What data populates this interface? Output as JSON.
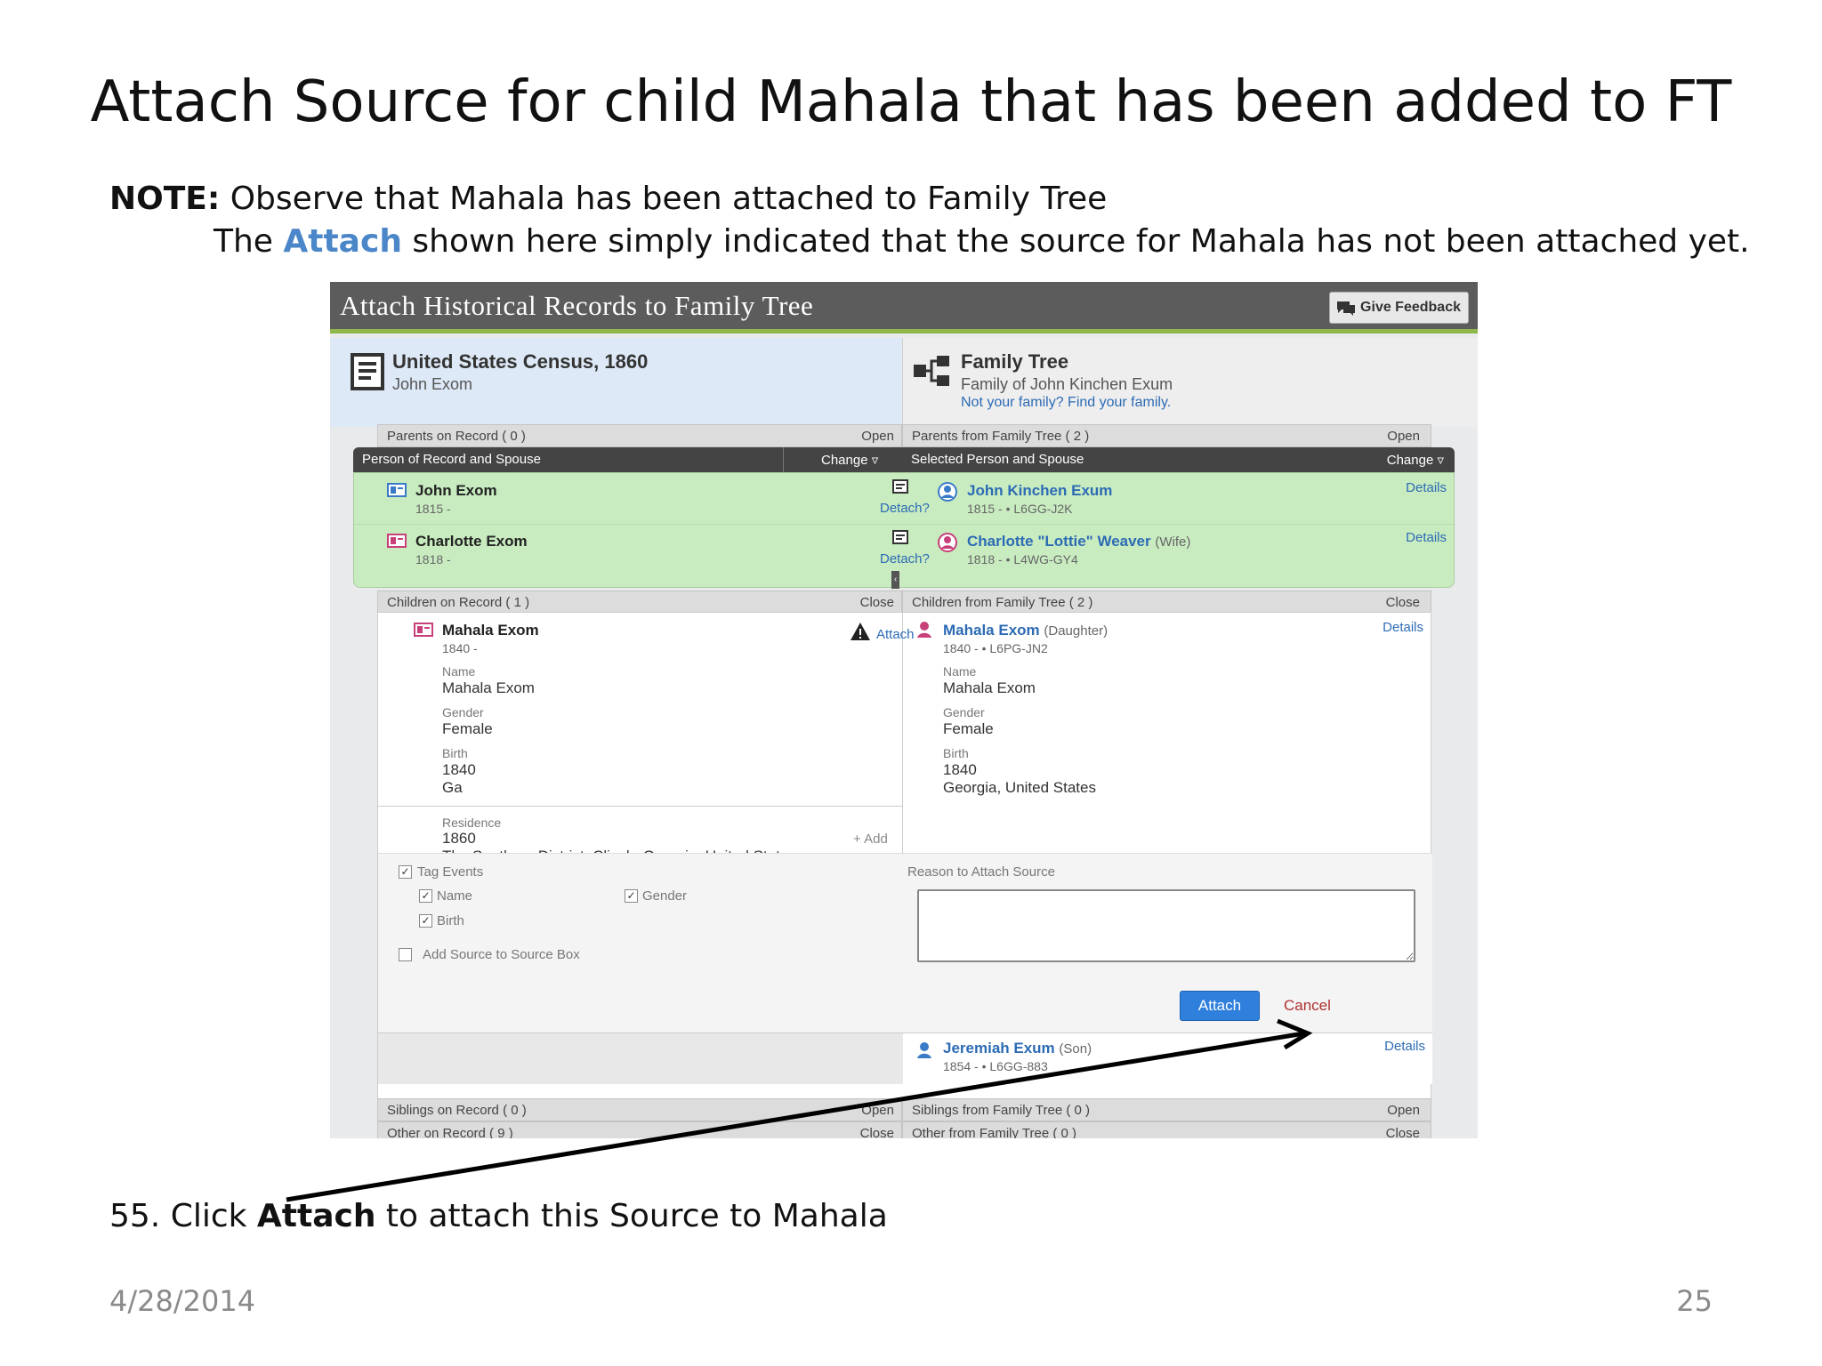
{
  "slide": {
    "title": "Attach Source for child Mahala that has been added to FT",
    "note_label": "NOTE:",
    "note_text": " Observe that Mahala has been attached to Family Tree",
    "note2_pre": "The ",
    "note2_highlight": "Attach",
    "note2_post": " shown here simply indicated that the source for Mahala has not been attached yet.",
    "step_pre": "55.  Click ",
    "step_bold": "Attach",
    "step_post": " to attach this Source to Mahala",
    "date": "4/28/2014",
    "page_number": "25"
  },
  "app": {
    "title": "Attach Historical Records to Family Tree",
    "feedback_label": "Give Feedback",
    "source": {
      "title": "United States Census, 1860",
      "subtitle": "John Exom"
    },
    "family_tree": {
      "title": "Family Tree",
      "subtitle": "Family of John Kinchen Exum",
      "link": "Not your family? Find your family."
    },
    "parents_left": {
      "label": "Parents on Record  ( 0 )",
      "action": "Open"
    },
    "parents_right": {
      "label": "Parents from Family Tree  ( 2 )",
      "action": "Open"
    },
    "person_bar_left": {
      "label": "Person of Record and Spouse",
      "action": "Change"
    },
    "person_bar_right": {
      "label": "Selected Person and Spouse",
      "action": "Change"
    },
    "record_persons": [
      {
        "name": "John Exom",
        "dates": "1815 -",
        "action": "Detach?"
      },
      {
        "name": "Charlotte Exom",
        "dates": "1818 -",
        "action": "Detach?"
      }
    ],
    "tree_persons": [
      {
        "name": "John Kinchen Exum",
        "relation": "",
        "dates": "1815 - • L6GG-J2K",
        "action": "Details"
      },
      {
        "name": "Charlotte \"Lottie\" Weaver",
        "relation": "(Wife)",
        "dates": "1818 - • L4WG-GY4",
        "action": "Details"
      }
    ],
    "children_left": {
      "label": "Children on Record  ( 1 )",
      "action": "Close"
    },
    "children_right": {
      "label": "Children from Family Tree  ( 2 )",
      "action": "Close"
    },
    "child_record": {
      "name": "Mahala Exom",
      "dates": "1840 -",
      "attach_label": "Attach",
      "name_label": "Name",
      "name_value": "Mahala Exom",
      "gender_label": "Gender",
      "gender_value": "Female",
      "birth_label": "Birth",
      "birth_year": "1840",
      "birth_place": "Ga",
      "residence_label": "Residence",
      "residence_year": "1860",
      "residence_place": "The Southern District, Clinch, Georgia, United States",
      "add_label": "+ Add"
    },
    "child_tree": {
      "name": "Mahala Exom",
      "relation": "(Daughter)",
      "dates": "1840 - • L6PG-JN2",
      "action": "Details",
      "name_label": "Name",
      "name_value": "Mahala Exom",
      "gender_label": "Gender",
      "gender_value": "Female",
      "birth_label": "Birth",
      "birth_year": "1840",
      "birth_place": "Georgia, United States"
    },
    "form": {
      "tag_events": "Tag Events",
      "name": "Name",
      "gender": "Gender",
      "birth": "Birth",
      "add_source_box": "Add Source to Source Box",
      "reason_label": "Reason to Attach Source",
      "attach_button": "Attach",
      "cancel": "Cancel"
    },
    "child2": {
      "name": "Jeremiah Exum",
      "relation": "(Son)",
      "dates": "1854 - • L6GG-883",
      "action": "Details"
    },
    "siblings_left": {
      "label": "Siblings on Record  ( 0 )",
      "action": "Open"
    },
    "siblings_right": {
      "label": "Siblings from Family Tree  ( 0 )",
      "action": "Open"
    },
    "other_left": {
      "label": "Other on Record  ( 9 )",
      "action": "Close"
    },
    "other_right": {
      "label": "Other from Family Tree  ( 0 )",
      "action": "Close"
    }
  },
  "colors": {
    "header": "#5c5c5c",
    "accent_green": "#8fb74a",
    "link_blue": "#2d6bb5",
    "attach_button": "#2f7fdc",
    "green_panel": "#c8ecc0"
  }
}
